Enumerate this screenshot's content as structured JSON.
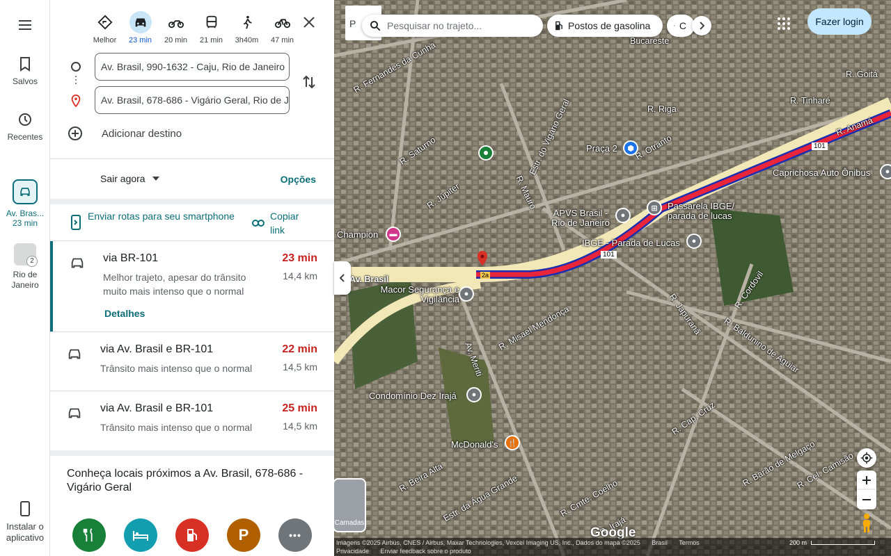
{
  "rail": {
    "saved": "Salvos",
    "recent": "Recentes",
    "active_trip": "Av. Bras...",
    "active_time": "23 min",
    "rio": "Rio de Janeiro",
    "rio_badge": "2",
    "install": "Instalar o aplicativo"
  },
  "modes": [
    {
      "label": "Melhor",
      "icon": "best-route-icon"
    },
    {
      "label": "23 min",
      "icon": "car-icon",
      "selected": true
    },
    {
      "label": "20 min",
      "icon": "motorcycle-icon"
    },
    {
      "label": "21 min",
      "icon": "bus-icon"
    },
    {
      "label": "3h40m",
      "icon": "walk-icon"
    },
    {
      "label": "47 min",
      "icon": "bike-icon"
    }
  ],
  "origin": "Av. Brasil, 990-1632 - Caju, Rio de Janeiro",
  "destination": "Av. Brasil, 678-686 - Vigário Geral, Rio de Janeiro",
  "add_destination": "Adicionar destino",
  "depart": "Sair agora",
  "options": "Opções",
  "send_routes": "Enviar rotas para seu smartphone",
  "copy_link": "Copiar link",
  "routes": [
    {
      "name": "via BR-101",
      "desc": "Melhor trajeto, apesar do trânsito muito mais intenso que o normal",
      "time": "23 min",
      "dist": "14,4 km",
      "details": "Detalhes"
    },
    {
      "name": "via Av. Brasil e BR-101",
      "desc": "Trânsito mais intenso que o normal",
      "time": "22 min",
      "dist": "14,5 km"
    },
    {
      "name": "via Av. Brasil e BR-101",
      "desc": "Trânsito mais intenso que o normal",
      "time": "25 min",
      "dist": "14,5 km"
    }
  ],
  "nearby_title": "Conheça locais próximos a Av. Brasil, 678-686 - Vigário Geral",
  "nearby_cats": [
    {
      "icon": "restaurant-icon",
      "color": "#188038"
    },
    {
      "icon": "hotel-icon",
      "color": "#129eaf"
    },
    {
      "icon": "gas-station-icon",
      "color": "#d93025"
    },
    {
      "icon": "parking-icon",
      "color": "#b06000",
      "glyph": "P"
    },
    {
      "icon": "more-icon",
      "color": "#70757a",
      "glyph": "•••"
    }
  ],
  "map": {
    "search_placeholder": "Pesquisar no trajeto...",
    "partial_label": "P",
    "chip_gas": "Postos de gasolina",
    "chip_partial": "C",
    "login": "Fazer login",
    "layers": "Camadas",
    "google": "Google",
    "footer_line1": [
      "Imagens ©2025 Airbus, CNES / Airbus, Maxar Technologies, Vexcel Imaging US, Inc., Dados do mapa ©2025",
      "Brasil",
      "Termos"
    ],
    "footer_line2": [
      "Privacidade",
      "Enviar feedback sobre o produto"
    ],
    "scale": "200 m",
    "route_colors": {
      "traffic": "#e8253a",
      "border": "#1a2fb0",
      "road": "#f2e7b7"
    },
    "street_labels": [
      "R. Fernandes da Cunha",
      "R. Saturno",
      "R. Júpiter",
      "R. Mauro",
      "Estr. do Vigário Geral",
      "R. Riga",
      "R. Otranto",
      "R. Anamá",
      "R. Tinharé",
      "Bucareste",
      "R. Goitá",
      "Av. Brasil",
      "R. Misael Mendonça",
      "Av. Meriti",
      "R. Japuranã",
      "R. Cordovil",
      "R. Baldunino de Aguiar",
      "R. Cap. Cruz",
      "R. Barão de Melgaço",
      "R. Cel. Camisão",
      "R. Beira Alta",
      "Estr. da Água Grande",
      "R. Cmte. Coelho",
      "R. Irajá",
      "101",
      "2a"
    ],
    "pois": [
      {
        "name": "Praça 2"
      },
      {
        "name": "APVS Brasil - Rio de Janeiro"
      },
      {
        "name": "Passarela IBGE/ parada de lucas"
      },
      {
        "name": "IBGE - Parada de Lucas"
      },
      {
        "name": "Caprichosa Auto Ônibus"
      },
      {
        "name": "Champion"
      },
      {
        "name": "Macor Segurança e Vigilância"
      },
      {
        "name": "Condomínio Dez Irajá"
      },
      {
        "name": "McDonald's"
      }
    ]
  }
}
